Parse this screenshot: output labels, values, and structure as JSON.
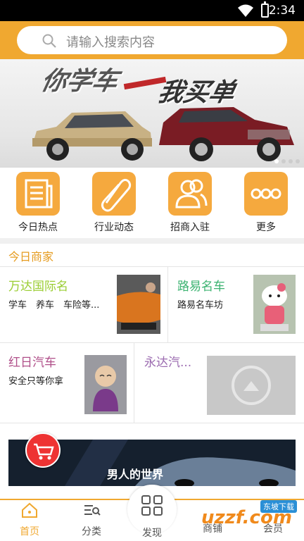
{
  "status": {
    "time": "2:34"
  },
  "search": {
    "placeholder": "请输入搜索内容"
  },
  "banner": {
    "slogan_left": "你学车",
    "slogan_right": "我买单"
  },
  "quick_nav": [
    {
      "label": "今日热点",
      "icon": "newspaper-icon"
    },
    {
      "label": "行业动态",
      "icon": "paperclip-icon"
    },
    {
      "label": "招商入驻",
      "icon": "people-icon"
    },
    {
      "label": "更多",
      "icon": "more-dots-icon"
    }
  ],
  "section": {
    "title": "今日商家"
  },
  "shops": [
    {
      "name": "万达国际名",
      "desc": "学车　养车　车险等...",
      "color": "#9acd32"
    },
    {
      "name": "路易名车",
      "desc": "路易名车坊",
      "color": "#3cb371"
    },
    {
      "name": "红日汽车",
      "desc": "安全只等你拿",
      "color": "#b0508a"
    },
    {
      "name": "永达汽...",
      "desc": "",
      "color": "#9b6bb0"
    }
  ],
  "ad": {
    "title": "男人的世界"
  },
  "tabs": [
    {
      "label": "首页",
      "icon": "home-icon"
    },
    {
      "label": "分类",
      "icon": "category-icon"
    },
    {
      "label": "发现",
      "icon": "grid-icon"
    },
    {
      "label": "商铺",
      "icon": "shop-icon"
    },
    {
      "label": "会员",
      "icon": "member-icon"
    }
  ],
  "watermark": {
    "brand": "uzzf.com",
    "tagline": "东坡下载"
  },
  "colors": {
    "accent": "#f0a830",
    "icon_bg": "#f5a93e",
    "cart": "#e33333"
  }
}
